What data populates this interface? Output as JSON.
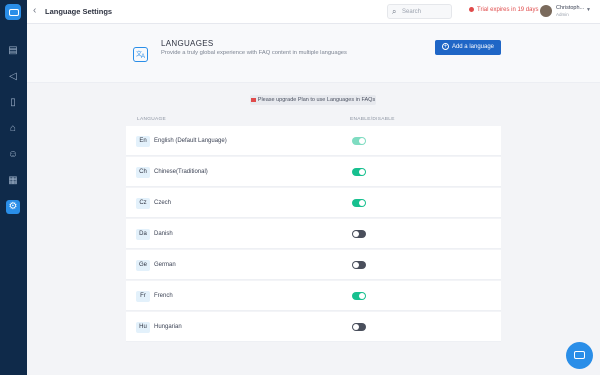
{
  "topbar": {
    "title": "Language Settings",
    "search_placeholder": "Search",
    "trial_text": "Trial expires in 19 days",
    "user_name": "Christoph...",
    "user_role": "Admin"
  },
  "hero": {
    "heading": "LANGUAGES",
    "description": "Provide a truly global experience with FAQ content in multiple languages",
    "add_button": "Add a language"
  },
  "notice": "Please upgrade Plan to use Languages in FAQs",
  "columns": {
    "language": "LANGUAGE",
    "enable": "ENABLE/DISABLE"
  },
  "languages": [
    {
      "code": "En",
      "name": "English (Default Language)",
      "enabled": true
    },
    {
      "code": "Ch",
      "name": "Chinese(Traditional)",
      "enabled": true
    },
    {
      "code": "Cz",
      "name": "Czech",
      "enabled": true
    },
    {
      "code": "Da",
      "name": "Danish",
      "enabled": false
    },
    {
      "code": "Ge",
      "name": "German",
      "enabled": false
    },
    {
      "code": "Fr",
      "name": "French",
      "enabled": true
    },
    {
      "code": "Hu",
      "name": "Hungarian",
      "enabled": false
    }
  ],
  "colors": {
    "accent": "#1f66c6",
    "toggle_on": "#17c08f",
    "sidebar": "#0f2a4a",
    "warning": "#e04b4b"
  }
}
